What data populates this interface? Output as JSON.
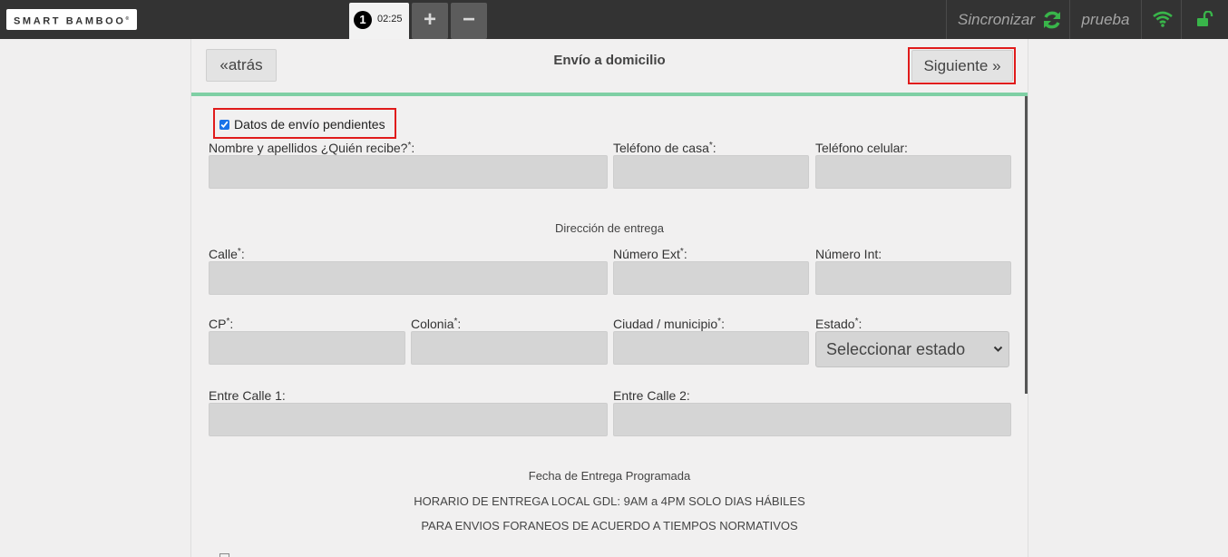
{
  "topbar": {
    "logo": "SMART BAMBOO",
    "logo_mark": "®",
    "ticket_number": "1",
    "ticket_time": "02:25",
    "add_label": "+",
    "remove_label": "−",
    "sync_label": "Sincronizar",
    "user_label": "prueba",
    "colors": {
      "bg": "#333333",
      "accent_green": "#39b54a"
    },
    "icons": [
      "sync-icon",
      "wifi-icon",
      "unlock-icon"
    ]
  },
  "header": {
    "back_label": "atrás",
    "back_icon": "«",
    "title": "Envío a domicilio",
    "next_label": "Siguiente",
    "next_icon": "»"
  },
  "form": {
    "pending_checkbox": {
      "label": "Datos de envío pendientes",
      "checked": true
    },
    "labels": {
      "nombre": "Nombre y apellidos ¿Quién recibe?",
      "tel_casa": "Teléfono de casa",
      "tel_cel": "Teléfono celular:",
      "calle": "Calle",
      "num_ext": "Número Ext",
      "num_int": "Número Int:",
      "cp": "CP",
      "colonia": "Colonia",
      "ciudad": "Ciudad / municipio",
      "estado": "Estado",
      "entre1": "Entre Calle 1:",
      "entre2": "Entre Calle 2:"
    },
    "required_mark": "*",
    "colon": ":",
    "section_direccion": "Dirección de entrega",
    "estado_selected": "Seleccionar estado",
    "section_fecha": "Fecha de Entrega Programada",
    "horario_line1": "HORARIO DE ENTREGA LOCAL GDL: 9AM a 4PM SOLO DIAS HÁBILES",
    "horario_line2": "PARA ENVIOS FORANEOS DE ACUERDO A TIEMPOS NORMATIVOS"
  }
}
